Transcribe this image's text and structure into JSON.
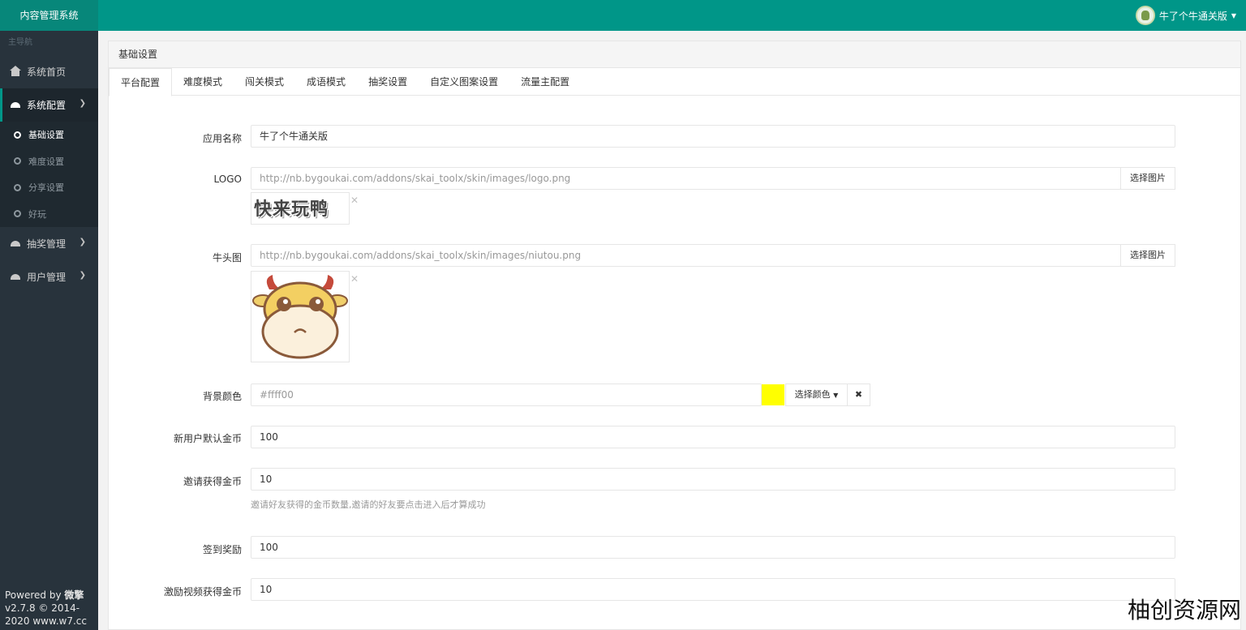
{
  "app": {
    "title": "内容管理系统"
  },
  "user": {
    "name": "牛了个牛通关版"
  },
  "sidebar": {
    "header": "主导航",
    "items": [
      {
        "label": "系统首页",
        "icon": "home-icon"
      },
      {
        "label": "系统配置",
        "icon": "dashboard-icon",
        "active": true
      },
      {
        "label": "抽奖管理",
        "icon": "dashboard-icon"
      },
      {
        "label": "用户管理",
        "icon": "dashboard-icon"
      }
    ],
    "sub_items": [
      {
        "label": "基础设置",
        "active": true
      },
      {
        "label": "难度设置"
      },
      {
        "label": "分享设置"
      },
      {
        "label": "好玩"
      }
    ],
    "footer_prefix": "Powered by ",
    "footer_brand": "微擎",
    "footer_version": "v2.7.8 © 2014-",
    "footer_site": "2020 www.w7.cc"
  },
  "panel": {
    "title": "基础设置"
  },
  "tabs": [
    "平台配置",
    "难度模式",
    "闯关模式",
    "成语模式",
    "抽奖设置",
    "自定义图案设置",
    "流量主配置"
  ],
  "form": {
    "app_name": {
      "label": "应用名称",
      "value": "牛了个牛通关版"
    },
    "logo": {
      "label": "LOGO",
      "value": "http://nb.bygoukai.com/addons/skai_toolx/skin/images/logo.png",
      "button": "选择图片",
      "preview_text": "快来玩鸭"
    },
    "niutou": {
      "label": "牛头图",
      "value": "http://nb.bygoukai.com/addons/skai_toolx/skin/images/niutou.png",
      "button": "选择图片"
    },
    "bg_color": {
      "label": "背景颜色",
      "value": "#ffff00",
      "placeholder": "#ffff00",
      "display": "#ffff00",
      "swatch": "#ffff00",
      "button": "选择颜色"
    },
    "new_user_coins": {
      "label": "新用户默认金币",
      "value": "100"
    },
    "invite_coins": {
      "label": "邀请获得金币",
      "value": "10",
      "help": "邀请好友获得的金币数量,邀请的好友要点击进入后才算成功"
    },
    "signin_reward": {
      "label": "签到奖励",
      "value": "100"
    },
    "video_coins": {
      "label": "激励视频获得金币",
      "value": "10"
    }
  },
  "watermark": "柚创资源网",
  "colors": {
    "topbar": "#009688",
    "sidebar": "#28333c",
    "accent": "#009688"
  }
}
